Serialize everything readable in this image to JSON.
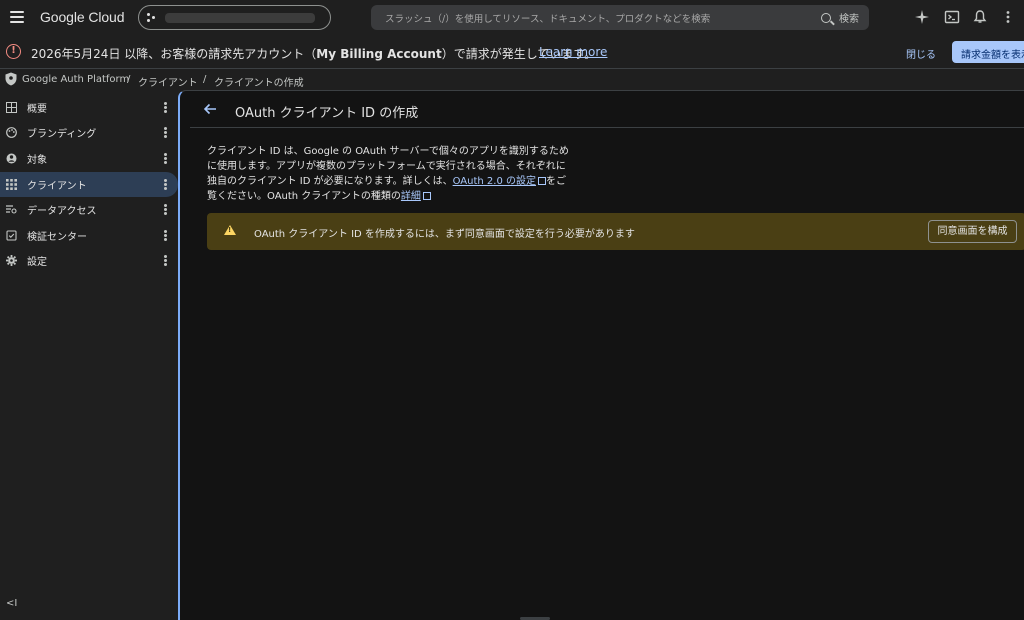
{
  "topbar": {
    "logo": "Google Cloud",
    "search_placeholder": "スラッシュ（/）を使用してリソース、ドキュメント、プロダクトなどを検索",
    "search_button": "検索",
    "icons": [
      "menu-icon",
      "sparkle-icon",
      "terminal-icon",
      "bell-icon",
      "more-vert-icon"
    ]
  },
  "banner": {
    "message_prefix": "2026年5月24日 以降、お客様の請求先アカウント（",
    "account": "My Billing Account",
    "message_suffix": "）で請求が発生しています。",
    "learn_more": "Learn more",
    "close": "閉じる",
    "show_button": "請求金額を表示"
  },
  "breadcrumb": {
    "items": [
      "Google Auth Platform",
      "クライアント",
      "クライアントの作成"
    ],
    "separator": "/"
  },
  "sidebar": {
    "items": [
      {
        "label": "概要",
        "icon": "dashboard-icon"
      },
      {
        "label": "ブランディング",
        "icon": "palette-icon"
      },
      {
        "label": "対象",
        "icon": "person-icon"
      },
      {
        "label": "クライアント",
        "icon": "apps-icon",
        "active": true
      },
      {
        "label": "データアクセス",
        "icon": "data-access-icon"
      },
      {
        "label": "検証センター",
        "icon": "verify-icon"
      },
      {
        "label": "設定",
        "icon": "gear-icon"
      }
    ],
    "collapse_label": "<I"
  },
  "panel": {
    "title": "OAuth クライアント ID の作成",
    "desc_1": "クライアント ID は、Google の OAuth サーバーで個々のアプリを識別するために使用します。アプリが複数のプラットフォームで実行される場合、それぞれに独自のクライアント ID が必要になります。詳しくは、",
    "desc_link1": "OAuth 2.0 の設定",
    "desc_2": "をご覧ください。OAuth クライアントの種類の",
    "desc_link2": "詳細",
    "warning_text": "OAuth クライアント ID を作成するには、まず同意画面で設定を行う必要があります",
    "warning_button": "同意画面を構成"
  },
  "colors": {
    "accent": "#a8c7fa",
    "warning_bg": "#4a3f14",
    "active_nav": "#2d3e55",
    "error": "#f28b82"
  }
}
